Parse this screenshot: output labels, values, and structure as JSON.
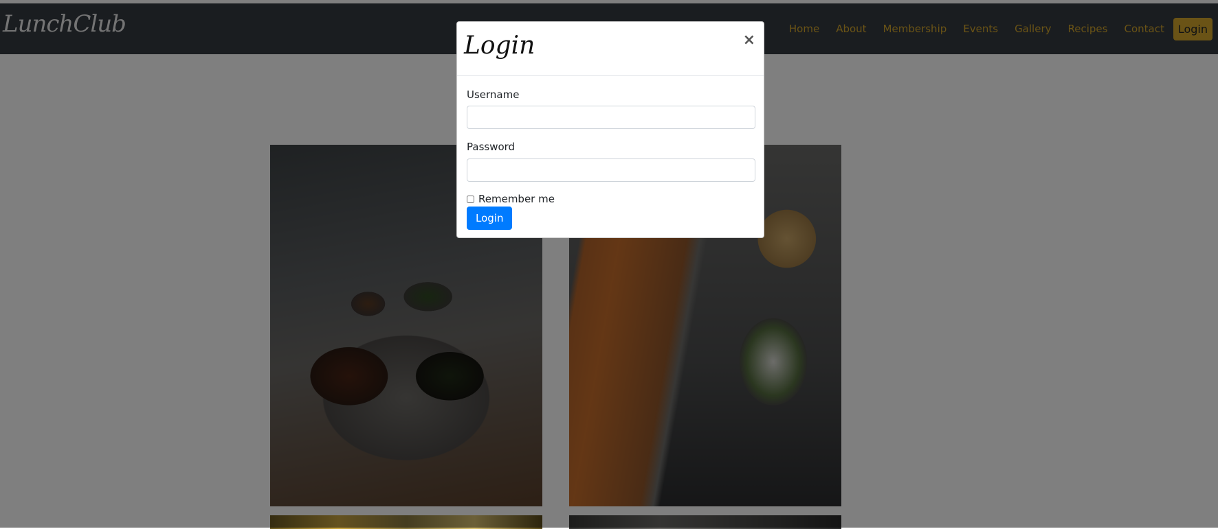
{
  "brand": {
    "name": "LunchClub"
  },
  "nav": {
    "links": [
      "Home",
      "About",
      "Membership",
      "Events",
      "Gallery",
      "Recipes",
      "Contact"
    ],
    "login_label": "Login"
  },
  "modal": {
    "title": "Login",
    "close_label": "×",
    "username_label": "Username",
    "username_value": "",
    "password_label": "Password",
    "password_value": "",
    "remember_label": "Remember me",
    "remember_checked": false,
    "submit_label": "Login"
  },
  "colors": {
    "navbar_bg": "#343a40",
    "nav_link": "#d4a72c",
    "nav_login_bg": "#d4a72c",
    "primary_button": "#007bff",
    "backdrop": "rgba(0,0,0,0.5)"
  }
}
